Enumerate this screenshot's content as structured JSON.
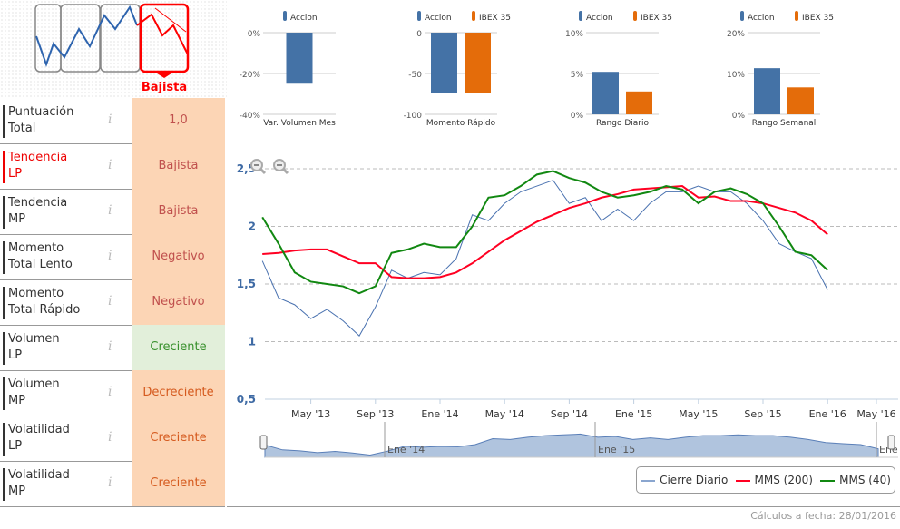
{
  "trend_widget": {
    "label": "Bajista",
    "color": "#ff0000"
  },
  "rows": [
    {
      "label": "Puntuación\nTotal",
      "value": "1,0",
      "bg": "#fcd5b5",
      "color": "#c0504d",
      "bar": "#333"
    },
    {
      "label": "Tendencia\nLP",
      "value": "Bajista",
      "bg": "#fcd5b5",
      "color": "#c0504d",
      "bar": "#e00",
      "label_color": "#e00"
    },
    {
      "label": "Tendencia\nMP",
      "value": "Bajista",
      "bg": "#fcd5b5",
      "color": "#c0504d",
      "bar": "#333"
    },
    {
      "label": "Momento\nTotal Lento",
      "value": "Negativo",
      "bg": "#fcd5b5",
      "color": "#c0504d",
      "bar": "#333"
    },
    {
      "label": "Momento\nTotal Rápido",
      "value": "Negativo",
      "bg": "#fcd5b5",
      "color": "#c0504d",
      "bar": "#333"
    },
    {
      "label": "Volumen\nLP",
      "value": "Creciente",
      "bg": "#e2efda",
      "color": "#38902c",
      "bar": "#333"
    },
    {
      "label": "Volumen\nMP",
      "value": "Decreciente",
      "bg": "#fcd5b5",
      "color": "#d55a1e",
      "bar": "#333"
    },
    {
      "label": "Volatilidad\nLP",
      "value": "Creciente",
      "bg": "#fcd5b5",
      "color": "#d55a1e",
      "bar": "#333"
    },
    {
      "label": "Volatilidad\nMP",
      "value": "Creciente",
      "bg": "#fcd5b5",
      "color": "#d55a1e",
      "bar": "#333"
    }
  ],
  "chart_data": [
    {
      "type": "bar",
      "xlabel": "Var. Volumen Mes",
      "ylim": [
        -40,
        0
      ],
      "ticks": [
        "0%",
        "-20%",
        "-40%"
      ],
      "tick_values": [
        0,
        -20,
        -40
      ],
      "series": [
        {
          "name": "Accion",
          "values": [
            -25
          ],
          "color": "#4472a6"
        }
      ]
    },
    {
      "type": "bar",
      "xlabel": "Momento Rápido",
      "ylim": [
        -100,
        0
      ],
      "ticks": [
        "0",
        "-50",
        "-100"
      ],
      "tick_values": [
        0,
        -50,
        -100
      ],
      "series": [
        {
          "name": "Accion",
          "values": [
            -74
          ],
          "color": "#4472a6"
        },
        {
          "name": "IBEX 35",
          "values": [
            -74
          ],
          "color": "#e46c0a"
        }
      ]
    },
    {
      "type": "bar",
      "xlabel": "Rango Diario",
      "ylim": [
        0,
        10
      ],
      "ticks": [
        "10%",
        "5%",
        "0%"
      ],
      "tick_values": [
        10,
        5,
        0
      ],
      "series": [
        {
          "name": "Accion",
          "values": [
            5.2
          ],
          "color": "#4472a6"
        },
        {
          "name": "IBEX 35",
          "values": [
            2.8
          ],
          "color": "#e46c0a"
        }
      ]
    },
    {
      "type": "bar",
      "xlabel": "Rango Semanal",
      "ylim": [
        0,
        20
      ],
      "ticks": [
        "20%",
        "10%",
        "0%"
      ],
      "tick_values": [
        20,
        10,
        0
      ],
      "series": [
        {
          "name": "Accion",
          "values": [
            11.3
          ],
          "color": "#4472a6"
        },
        {
          "name": "IBEX 35",
          "values": [
            6.6
          ],
          "color": "#e46c0a"
        }
      ]
    },
    {
      "type": "line",
      "ylim": [
        0.5,
        2.5
      ],
      "yticks": [
        "0,5",
        "1",
        "1,5",
        "2",
        "2,5"
      ],
      "ytick_values": [
        0.5,
        1,
        1.5,
        2,
        2.5
      ],
      "xticks": [
        "May '13",
        "Sep '13",
        "Ene '14",
        "May '14",
        "Sep '14",
        "Ene '15",
        "May '15",
        "Sep '15",
        "Ene '16",
        "May '16"
      ],
      "xtick_dates": [
        "2013-05",
        "2013-09",
        "2014-01",
        "2014-05",
        "2014-09",
        "2015-01",
        "2015-05",
        "2015-09",
        "2016-01",
        "2016-05"
      ],
      "x": [
        "2013-02",
        "2013-03",
        "2013-04",
        "2013-05",
        "2013-06",
        "2013-07",
        "2013-08",
        "2013-09",
        "2013-10",
        "2013-11",
        "2013-12",
        "2014-01",
        "2014-02",
        "2014-03",
        "2014-04",
        "2014-05",
        "2014-06",
        "2014-07",
        "2014-08",
        "2014-09",
        "2014-10",
        "2014-11",
        "2014-12",
        "2015-01",
        "2015-02",
        "2015-03",
        "2015-04",
        "2015-05",
        "2015-06",
        "2015-07",
        "2015-08",
        "2015-09",
        "2015-10",
        "2015-11",
        "2015-12",
        "2016-01"
      ],
      "series": [
        {
          "name": "Cierre Diario",
          "color": "#4a72b0",
          "values": [
            1.7,
            1.38,
            1.32,
            1.2,
            1.28,
            1.18,
            1.05,
            1.3,
            1.62,
            1.55,
            1.6,
            1.58,
            1.72,
            2.1,
            2.05,
            2.2,
            2.3,
            2.35,
            2.4,
            2.2,
            2.25,
            2.05,
            2.15,
            2.05,
            2.2,
            2.3,
            2.3,
            2.35,
            2.3,
            2.3,
            2.2,
            2.05,
            1.85,
            1.78,
            1.72,
            1.45
          ]
        },
        {
          "name": "MMS (200)",
          "color": "#ff0022",
          "values": [
            1.76,
            1.77,
            1.79,
            1.8,
            1.8,
            1.74,
            1.68,
            1.68,
            1.56,
            1.55,
            1.55,
            1.56,
            1.6,
            1.68,
            1.78,
            1.88,
            1.96,
            2.04,
            2.1,
            2.16,
            2.2,
            2.25,
            2.28,
            2.32,
            2.33,
            2.34,
            2.35,
            2.25,
            2.26,
            2.22,
            2.22,
            2.2,
            2.16,
            2.12,
            2.05,
            1.93
          ]
        },
        {
          "name": "MMS (40)",
          "color": "#118811",
          "values": [
            2.08,
            1.85,
            1.6,
            1.52,
            1.5,
            1.48,
            1.42,
            1.48,
            1.77,
            1.8,
            1.85,
            1.82,
            1.82,
            2.0,
            2.25,
            2.27,
            2.35,
            2.45,
            2.48,
            2.42,
            2.38,
            2.3,
            2.25,
            2.27,
            2.3,
            2.35,
            2.32,
            2.2,
            2.3,
            2.33,
            2.28,
            2.2,
            2.0,
            1.78,
            1.75,
            1.62
          ]
        }
      ],
      "navigator_labels": [
        "Ene '14",
        "Ene '15",
        "Ene"
      ]
    }
  ],
  "legend": [
    "Cierre Diario",
    "MMS (200)",
    "MMS (40)"
  ],
  "footer": "Cálculos a fecha: 28/01/2016"
}
